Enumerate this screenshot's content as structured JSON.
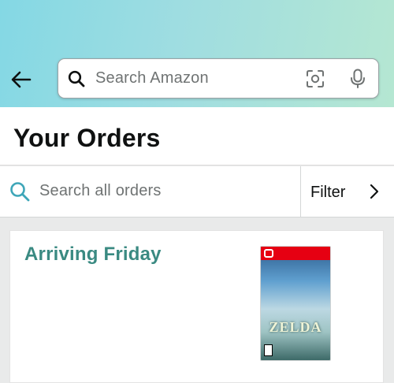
{
  "header": {
    "back_icon": "arrow-left-icon",
    "search": {
      "placeholder": "Search Amazon",
      "icons": [
        "search-icon",
        "camera-scan-icon",
        "microphone-icon"
      ]
    }
  },
  "page": {
    "title": "Your Orders"
  },
  "orders_search": {
    "placeholder": "Search all orders",
    "filter_label": "Filter"
  },
  "orders": [
    {
      "status": "Arriving Friday",
      "product_image_text": "ZELDA"
    }
  ],
  "colors": {
    "accent_teal": "#3a8a82",
    "search_icon": "#3ea6b8",
    "header_gradient_start": "#84d8e4",
    "header_gradient_end": "#b5e7d2"
  }
}
